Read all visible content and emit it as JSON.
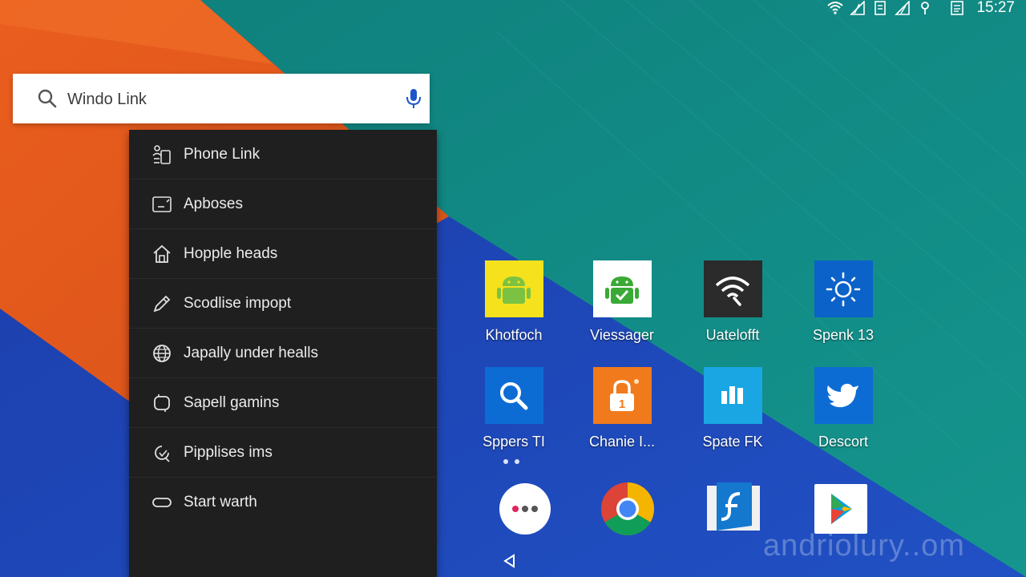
{
  "status_bar": {
    "time": "15:27",
    "icons": [
      "wifi-icon",
      "signal-icon",
      "sim-icon",
      "signal-icon",
      "location-icon",
      "notes-icon"
    ]
  },
  "search": {
    "value": "Windo Link",
    "placeholder": "",
    "colors": {
      "icon": "#5f6368",
      "mic": "#1a56c8"
    }
  },
  "suggestions": [
    {
      "label": "Phone Link",
      "icon": "phone-link-icon"
    },
    {
      "label": "Apboses",
      "icon": "window-icon"
    },
    {
      "label": "Hopple heads",
      "icon": "home-icon"
    },
    {
      "label": "Scodlise impopt",
      "icon": "pen-icon"
    },
    {
      "label": "Japally under healls",
      "icon": "globe-icon"
    },
    {
      "label": "Sapell gamins",
      "icon": "clock-icon"
    },
    {
      "label": "Pipplises ims",
      "icon": "refresh-icon"
    },
    {
      "label": "Start warth",
      "icon": "toggle-icon"
    }
  ],
  "apps": [
    {
      "label": "Khotfoch",
      "icon": "android-icon",
      "color": "#f5e21c"
    },
    {
      "label": "Viessager",
      "icon": "android-check-icon",
      "color": "#ffffff"
    },
    {
      "label": "Uatelofft",
      "icon": "wifi-icon",
      "color": "#2b2b2b"
    },
    {
      "label": "Spenk 13",
      "icon": "brightness-icon",
      "color": "#0b62c9"
    },
    {
      "label": "Sppers TI",
      "icon": "search-icon",
      "color": "#0d6cd4"
    },
    {
      "label": "Chanie I...",
      "icon": "lock-icon",
      "color": "#f07a1c"
    },
    {
      "label": "Spate FK",
      "icon": "bars-icon",
      "color": "#1aa6e3"
    },
    {
      "label": "Descort",
      "icon": "bird-icon",
      "color": "#0d6cd4"
    }
  ],
  "dock": [
    {
      "name": "more-apps-icon"
    },
    {
      "name": "chrome-icon"
    },
    {
      "name": "flash-icon"
    },
    {
      "name": "play-store-icon"
    }
  ],
  "watermark": "andriolury..om",
  "colors": {
    "teal": "#0f8a85",
    "orange": "#e8591c",
    "navy": "#1b3fae",
    "panel": "#1f1f1f"
  }
}
